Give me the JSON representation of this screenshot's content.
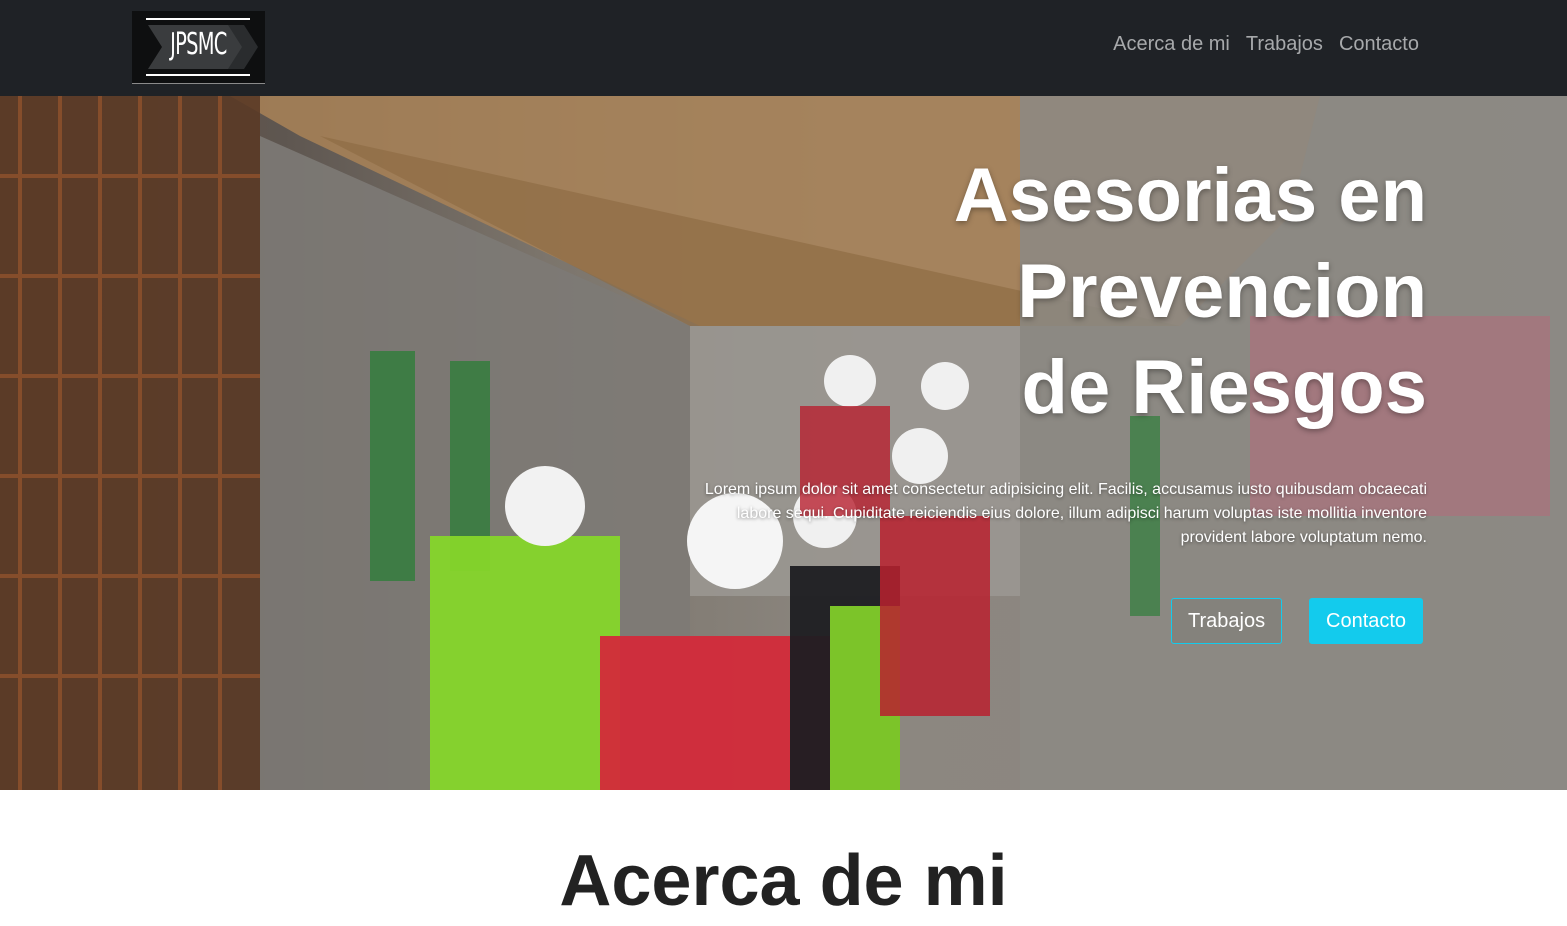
{
  "nav": {
    "logo_text": "JPSMC",
    "links": [
      "Acerca de mi",
      "Trabajos",
      "Contacto"
    ]
  },
  "hero": {
    "title_lines": [
      "Asesorias en",
      "Prevencion",
      "de Riesgos"
    ],
    "text": "Lorem ipsum dolor sit amet consectetur adipisicing elit. Facilis, accusamus iusto quibusdam obcaecati labore sequi. Cupiditate reiciendis eius dolore, illum adipisci harum voluptas iste mollitia inventore provident labore voluptatum nemo.",
    "buttons": {
      "outline": "Trabajos",
      "primary": "Contacto"
    }
  },
  "section": {
    "heading": "Acerca de mi"
  },
  "colors": {
    "navbar": "#1f2226",
    "accent": "#13cbed",
    "nav_text": "#a7a9ab"
  },
  "icons": [
    "logo-chevron-icon"
  ]
}
